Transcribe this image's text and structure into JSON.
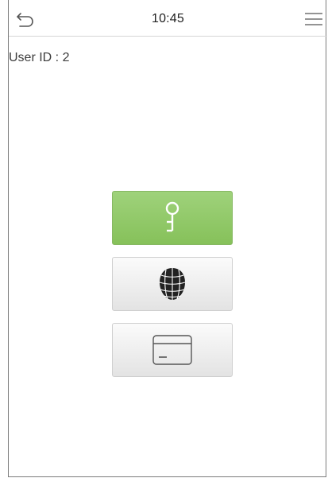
{
  "header": {
    "back_icon": "back-arrow-icon",
    "time": "10:45",
    "menu_icon": "hamburger-menu-icon"
  },
  "user": {
    "label": "User ID : 2"
  },
  "verification_options": [
    {
      "name": "password",
      "icon": "key-icon",
      "selected": true,
      "color": "#8fc866"
    },
    {
      "name": "face",
      "icon": "face-icon",
      "selected": false,
      "color": "#e8e8e8"
    },
    {
      "name": "card",
      "icon": "card-icon",
      "selected": false,
      "color": "#e8e8e8"
    }
  ]
}
